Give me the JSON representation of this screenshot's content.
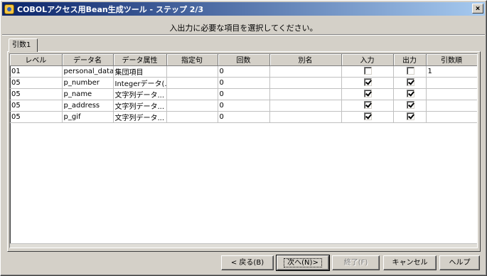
{
  "window": {
    "title": "COBOLアクセス用Bean生成ツール - ステップ 2/3",
    "close": "×"
  },
  "instruction": "入出力に必要な項目を選択してください。",
  "tab": {
    "label": "引数1"
  },
  "grid": {
    "columns": [
      "レベル",
      "データ名",
      "データ属性",
      "指定句",
      "回数",
      "別名",
      "入力",
      "出力",
      "引数順"
    ],
    "rows": [
      {
        "level": "01",
        "name": "personal_data",
        "type": "集団項目",
        "clause": "",
        "count": "0",
        "alias": "",
        "input": false,
        "output": false,
        "order": "1"
      },
      {
        "level": "05",
        "name": "p_number",
        "type": "Integerデータ(...",
        "clause": "",
        "count": "0",
        "alias": "",
        "input": true,
        "output": true,
        "order": ""
      },
      {
        "level": "05",
        "name": "p_name",
        "type": "文字列データ...",
        "clause": "",
        "count": "0",
        "alias": "",
        "input": true,
        "output": true,
        "order": ""
      },
      {
        "level": "05",
        "name": "p_address",
        "type": "文字列データ...",
        "clause": "",
        "count": "0",
        "alias": "",
        "input": true,
        "output": true,
        "order": ""
      },
      {
        "level": "05",
        "name": "p_gif",
        "type": "文字列データ...",
        "clause": "",
        "count": "0",
        "alias": "",
        "input": true,
        "output": true,
        "order": ""
      }
    ]
  },
  "buttons": {
    "back": "< 戻る(B)",
    "next": "次へ(N)>",
    "finish": "終了(F)",
    "cancel": "キャンセル",
    "help": "ヘルプ"
  }
}
